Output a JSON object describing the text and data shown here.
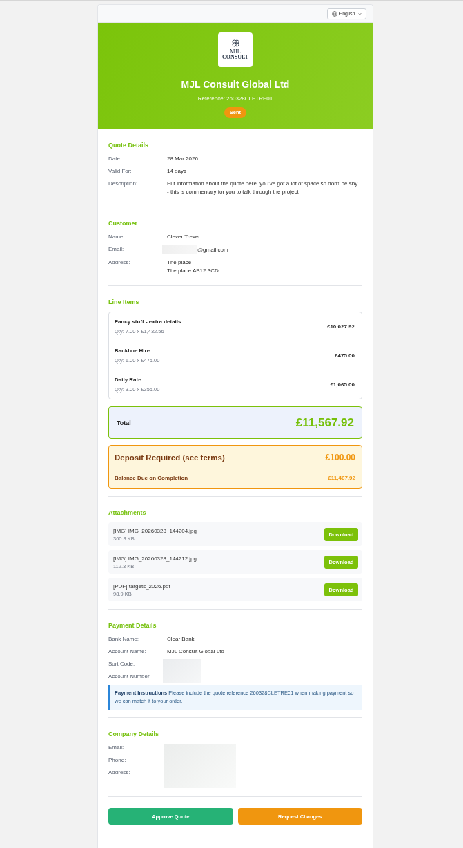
{
  "top_bar": {
    "language": "English"
  },
  "header": {
    "logo": {
      "lines": [
        "MJL",
        "CONSULT"
      ]
    },
    "company": "MJL Consult Global Ltd",
    "reference": "Reference: 260328CLETRE01",
    "status": "Sent"
  },
  "quote_details": {
    "title": "Quote Details",
    "rows": [
      {
        "label": "Date:",
        "lines": [
          "28 Mar 2026"
        ],
        "masked": false
      },
      {
        "label": "Valid For:",
        "lines": [
          "14 days"
        ],
        "masked": false
      },
      {
        "label": "Description:",
        "lines": [
          "Put information about the quote here. you've got a lot of space so don't be shy - this is commentary for you to talk through the project"
        ],
        "masked": false
      }
    ]
  },
  "customer": {
    "title": "Customer",
    "rows": [
      {
        "label": "Name:",
        "lines": [
          "Clever Trever"
        ],
        "masked": false
      },
      {
        "label": "Email:",
        "lines": [
          "@gmail.com"
        ],
        "masked": true
      },
      {
        "label": "Address:",
        "lines": [
          "The place",
          "The place AB12 3CD"
        ],
        "masked": false
      }
    ]
  },
  "line_items": {
    "title": "Line Items",
    "items": [
      {
        "name": "Fancy stuff - extra details",
        "qty": "Qty: 7.00 x £1,432.56",
        "amount": "£10,027.92"
      },
      {
        "name": "Backhoe Hire",
        "qty": "Qty: 1.00 x £475.00",
        "amount": "£475.00"
      },
      {
        "name": "Daily Rate",
        "qty": "Qty: 3.00 x £355.00",
        "amount": "£1,065.00"
      }
    ],
    "total": {
      "label": "Total",
      "amount": "£11,567.92"
    },
    "deposit": {
      "label": "Deposit Required (see terms)",
      "amount": "£100.00",
      "balance_label": "Balance Due on Completion",
      "balance_amount": "£11,467.92"
    }
  },
  "attachments": {
    "title": "Attachments",
    "files": [
      {
        "name": "[IMG] IMG_20260328_144204.jpg",
        "size": "360.3 KB",
        "action": "Download"
      },
      {
        "name": "[IMG] IMG_20260328_144212.jpg",
        "size": "112.3 KB",
        "action": "Download"
      },
      {
        "name": "[PDF] targets_2026.pdf",
        "size": "98.9 KB",
        "action": "Download"
      }
    ]
  },
  "payment": {
    "title": "Payment Details",
    "rows": [
      {
        "label": "Bank Name:",
        "lines": [
          "Clear Bank"
        ],
        "masked": false
      },
      {
        "label": "Account Name:",
        "lines": [
          "MJL Consult Global Ltd"
        ],
        "masked": false
      },
      {
        "label": "Sort Code:",
        "masked": true
      },
      {
        "label": "Account Number:",
        "masked": true
      }
    ],
    "instructions": "**Payment Instructions** Please include the quote reference 260328CLETRE01 when making payment so we can match it to your order."
  },
  "company_details": {
    "title": "Company Details",
    "rows": [
      {
        "label": "Email:",
        "masked": true
      },
      {
        "label": "Phone:",
        "masked": true
      },
      {
        "label": "Address:",
        "masked": true
      }
    ]
  },
  "actions": [
    {
      "label": "Approve Quote",
      "kind": "approve"
    },
    {
      "label": "Request Changes",
      "kind": "request"
    }
  ]
}
